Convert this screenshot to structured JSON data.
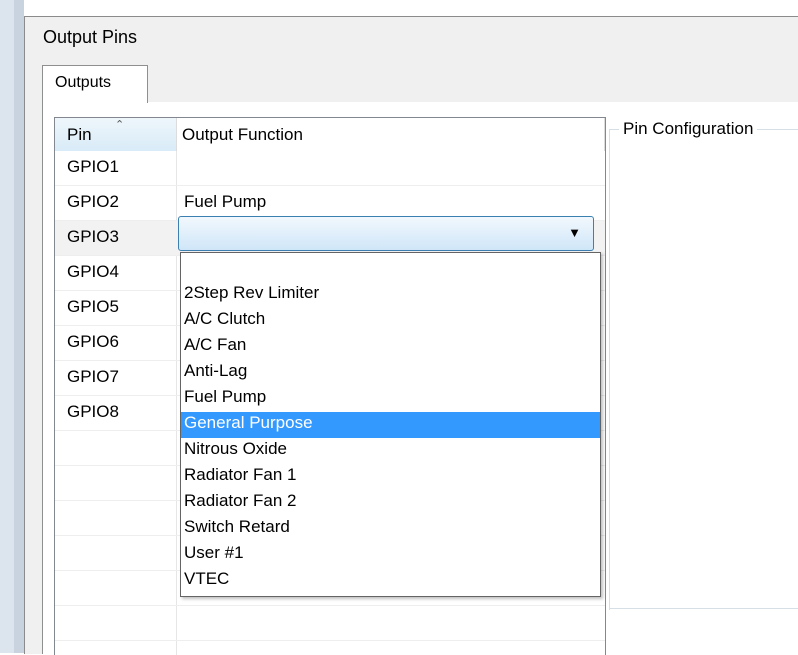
{
  "window": {
    "title": "Output Pins"
  },
  "tabs": [
    {
      "label": "Outputs"
    }
  ],
  "list": {
    "columns": [
      {
        "label": "Pin"
      },
      {
        "label": "Output Function"
      }
    ],
    "rows": [
      {
        "pin": "GPIO1",
        "function": ""
      },
      {
        "pin": "GPIO2",
        "function": "Fuel Pump"
      },
      {
        "pin": "GPIO3",
        "function": ""
      },
      {
        "pin": "GPIO4",
        "function": ""
      },
      {
        "pin": "GPIO5",
        "function": ""
      },
      {
        "pin": "GPIO6",
        "function": ""
      },
      {
        "pin": "GPIO7",
        "function": ""
      },
      {
        "pin": "GPIO8",
        "function": ""
      }
    ]
  },
  "combo": {
    "value": ""
  },
  "dropdown": {
    "options": [
      {
        "label": ""
      },
      {
        "label": "2Step Rev Limiter"
      },
      {
        "label": "A/C Clutch"
      },
      {
        "label": "A/C Fan"
      },
      {
        "label": "Anti-Lag"
      },
      {
        "label": "Fuel Pump"
      },
      {
        "label": "General Purpose"
      },
      {
        "label": "Nitrous Oxide"
      },
      {
        "label": "Radiator Fan 1"
      },
      {
        "label": "Radiator Fan 2"
      },
      {
        "label": "Switch Retard"
      },
      {
        "label": "User #1"
      },
      {
        "label": "VTEC"
      }
    ],
    "highlighted": "General Purpose"
  },
  "pin_config": {
    "title": "Pin Configuration"
  },
  "colors": {
    "highlight": "#3399ff",
    "combo_border": "#3c7fb1"
  },
  "icons": {
    "sort": "sort-ascending-icon",
    "dropdown": "chevron-down-icon"
  }
}
